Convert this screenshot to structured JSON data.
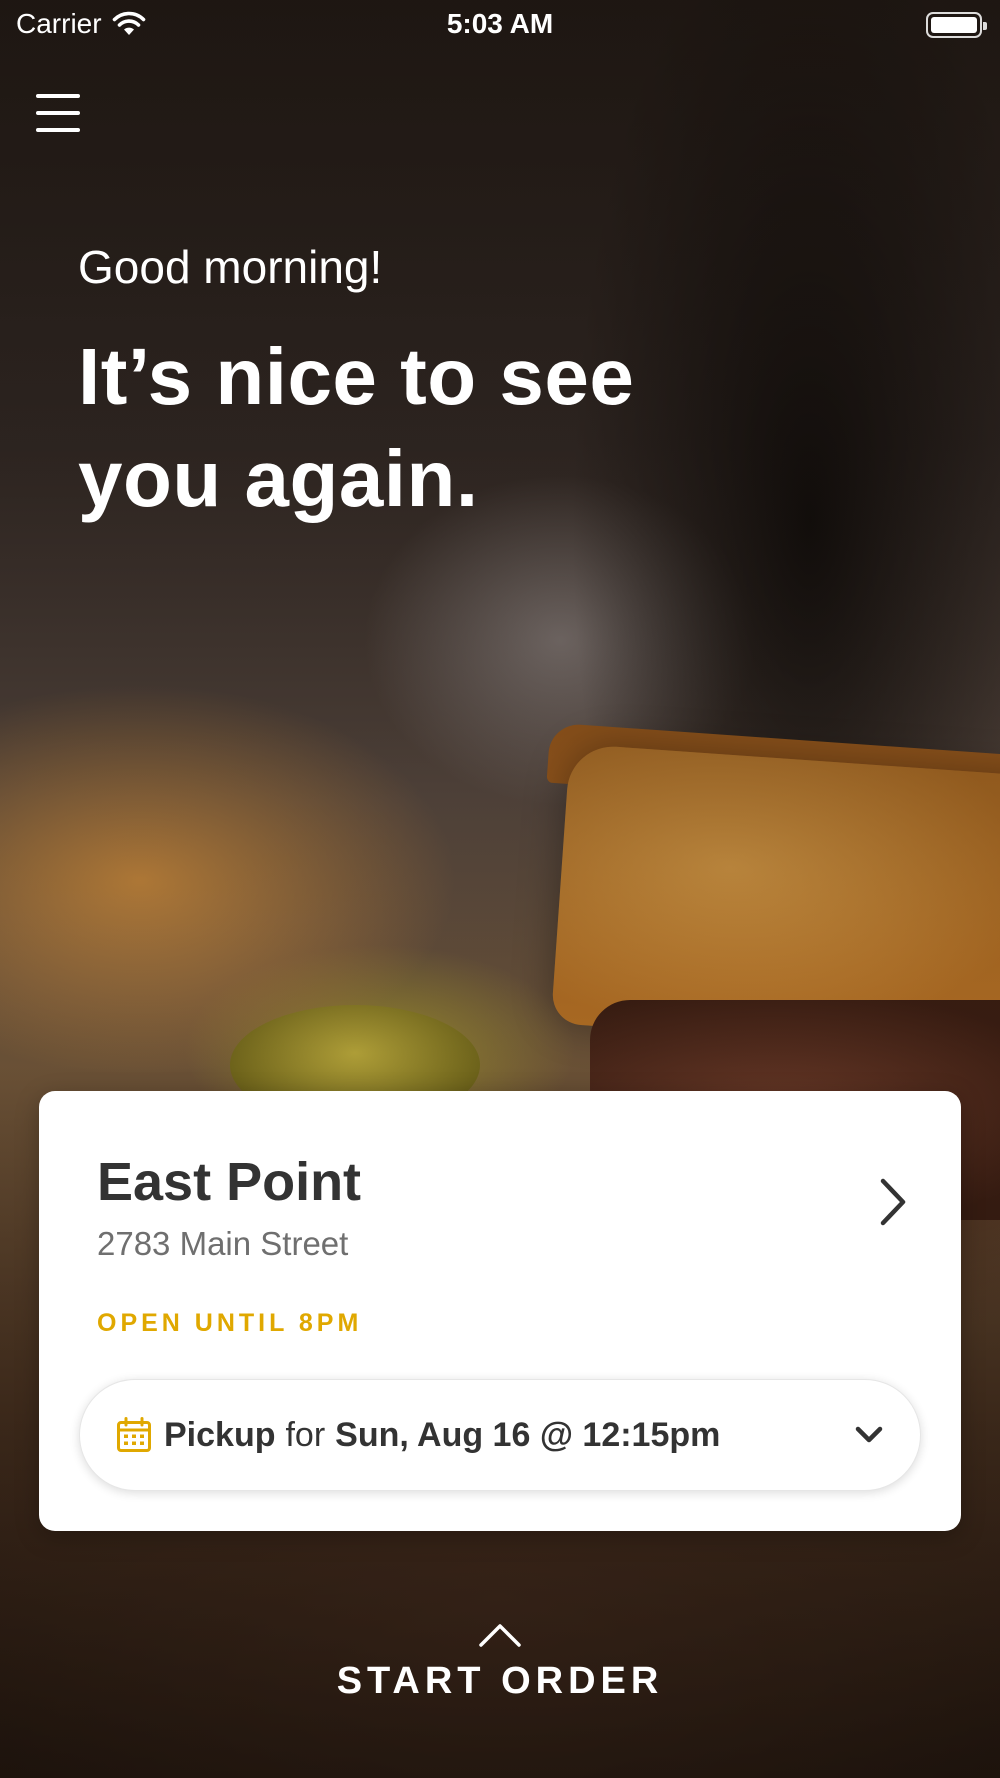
{
  "status_bar": {
    "carrier": "Carrier",
    "time": "5:03 AM"
  },
  "header": {
    "menu_icon": "hamburger-menu-icon"
  },
  "hero": {
    "greeting": "Good morning!",
    "title": "It’s nice to see you again."
  },
  "location_card": {
    "store_name": "East Point",
    "address": "2783 Main Street",
    "hours": "OPEN UNTIL 8PM",
    "pickup": {
      "mode": "Pickup",
      "connector": "for",
      "datetime": "Sun, Aug 16 @ 12:15pm"
    }
  },
  "footer": {
    "start_order_label": "START ORDER"
  },
  "colors": {
    "accent": "#e0a800",
    "card_background": "#ffffff",
    "text_dark": "#333333",
    "text_muted": "#6f6f6f"
  }
}
